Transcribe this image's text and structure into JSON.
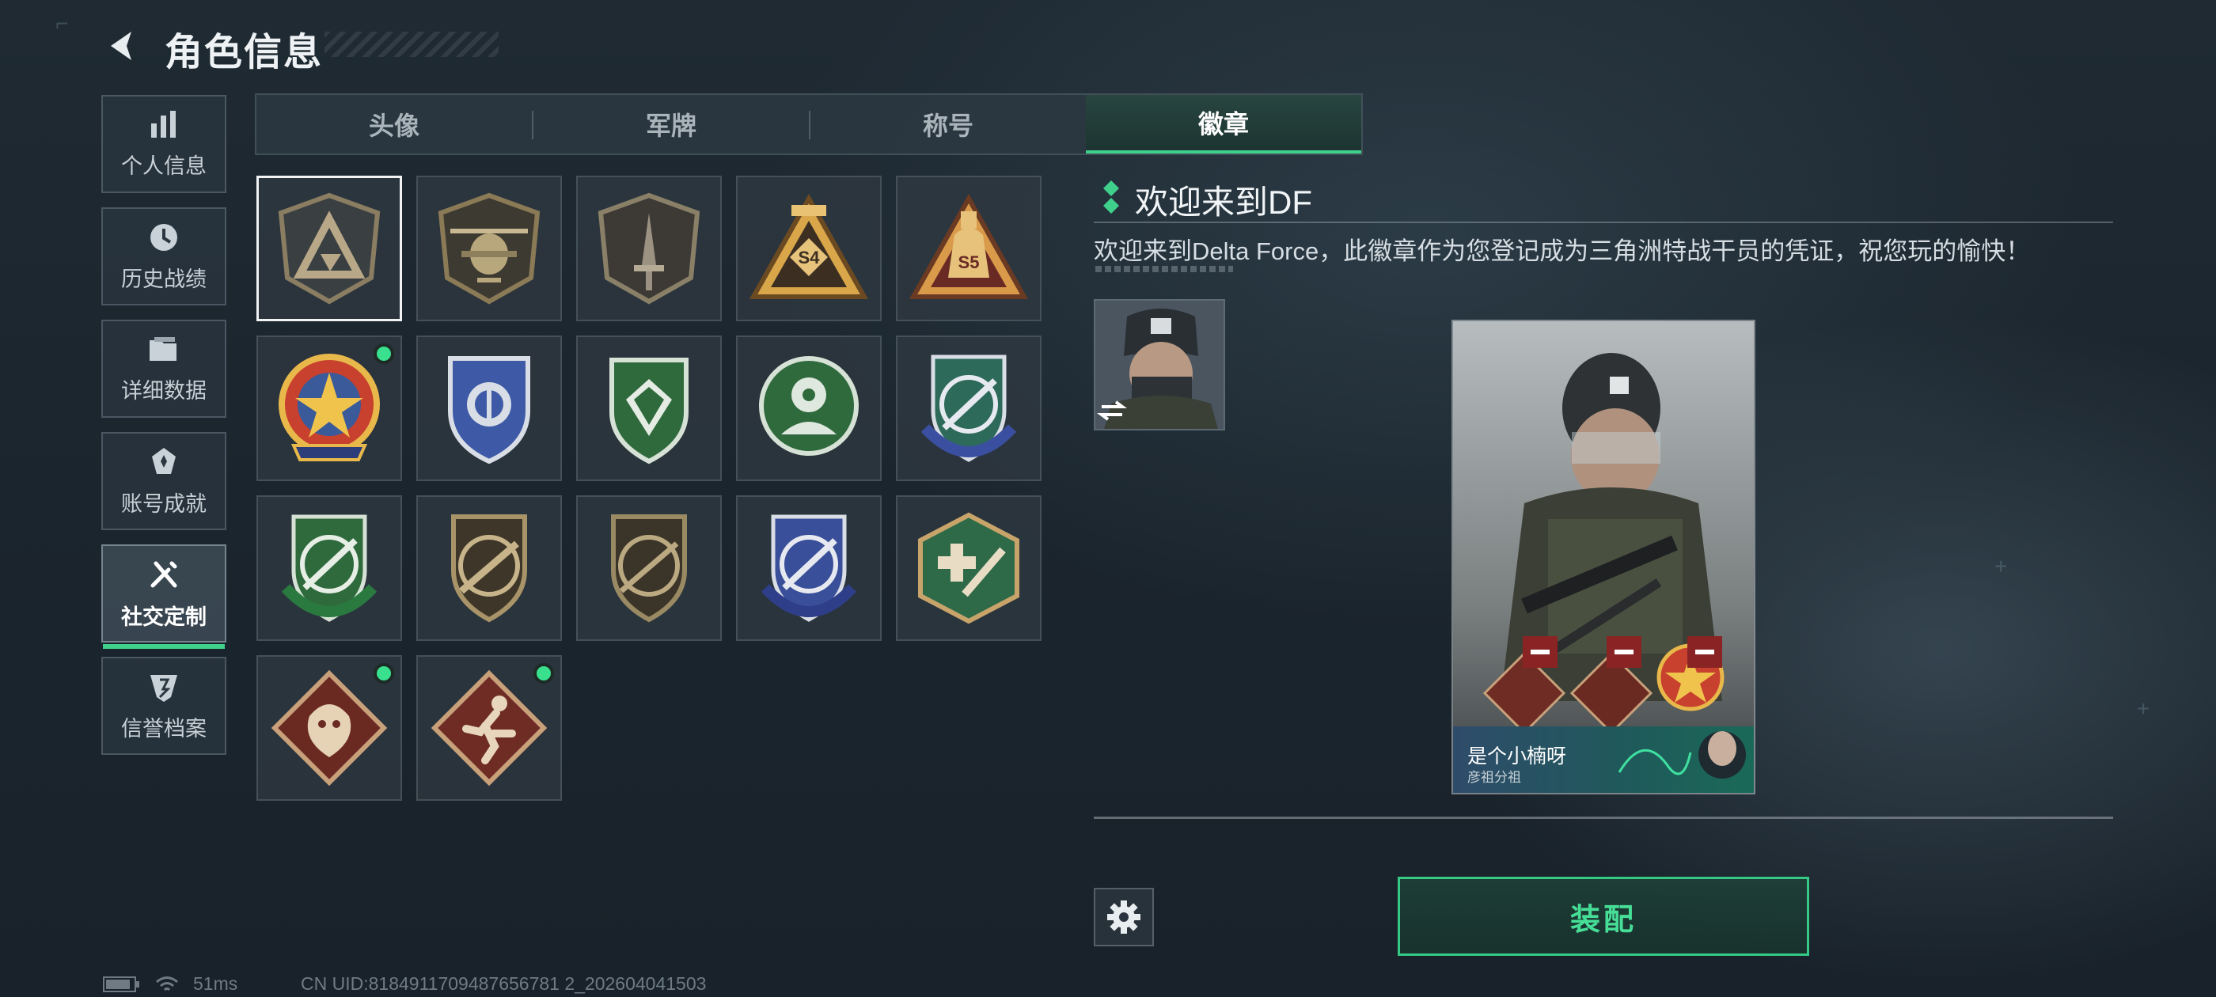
{
  "header": {
    "title": "角色信息"
  },
  "sidebar": {
    "items": [
      {
        "label": "个人信息",
        "icon": "bar-chart-icon"
      },
      {
        "label": "历史战绩",
        "icon": "clock-history-icon"
      },
      {
        "label": "详细数据",
        "icon": "folder-icon"
      },
      {
        "label": "账号成就",
        "icon": "achievement-icon"
      },
      {
        "label": "社交定制",
        "icon": "wrench-icon",
        "active": true
      },
      {
        "label": "信誉档案",
        "icon": "shield-reputation-icon"
      }
    ]
  },
  "tabs": [
    {
      "label": "头像"
    },
    {
      "label": "军牌"
    },
    {
      "label": "称号"
    },
    {
      "label": "徽章",
      "active": true
    }
  ],
  "badges": [
    {
      "name": "delta-triangle-badge",
      "selected": true
    },
    {
      "name": "helicopter-badge"
    },
    {
      "name": "dagger-badge"
    },
    {
      "name": "s4-badge",
      "text": "S4"
    },
    {
      "name": "s5-badge",
      "text": "S5"
    },
    {
      "name": "star-emblem-badge",
      "is_new": true
    },
    {
      "name": "blue-shield-badge"
    },
    {
      "name": "green-diamond-badge"
    },
    {
      "name": "green-soldier-badge"
    },
    {
      "name": "blue-rifle-wreath-badge"
    },
    {
      "name": "green-rifle-wreath-badge"
    },
    {
      "name": "brown-rifle-badge"
    },
    {
      "name": "brown-rifle-badge-2"
    },
    {
      "name": "blue-rifle-wreath-badge-2"
    },
    {
      "name": "medic-rifle-badge"
    },
    {
      "name": "dragon-badge",
      "is_new": true
    },
    {
      "name": "runner-badge",
      "is_new": true
    }
  ],
  "detail": {
    "title": "欢迎来到DF",
    "description": "欢迎来到Delta Force，此徽章作为您登记成为三角洲特战干员的凭证，祝您玩的愉快！"
  },
  "card": {
    "player_name": "是个小楠呀",
    "subtitle": "彦祖分祖"
  },
  "actions": {
    "equip_label": "装配"
  },
  "status": {
    "ping": "51ms",
    "uid": "CN UID:8184911709487656781 2_202604041503"
  },
  "colors": {
    "accent": "#3fd18c",
    "equip_text": "#46dd97",
    "new_dot": "#39e08e"
  }
}
